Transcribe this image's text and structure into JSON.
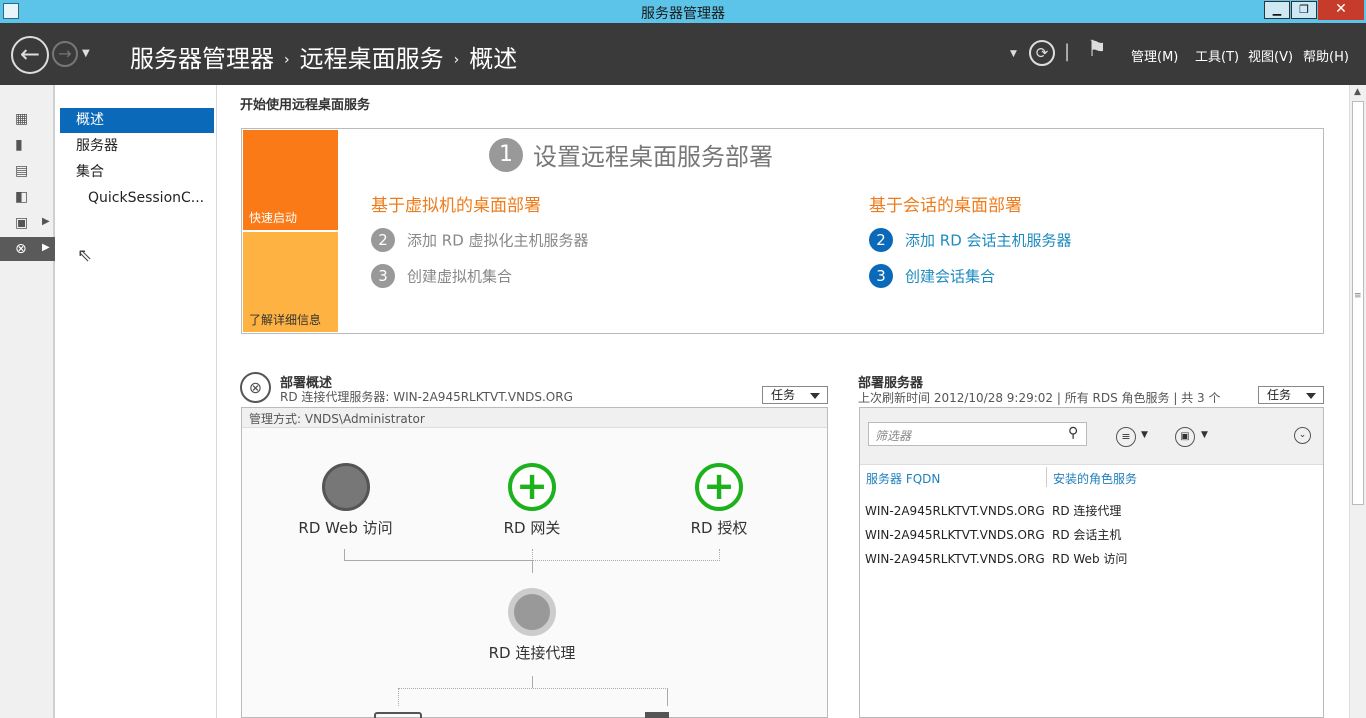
{
  "window": {
    "title": "服务器管理器",
    "min": "▁",
    "max": "❐",
    "close": "✕"
  },
  "header": {
    "breadcrumb": [
      "服务器管理器",
      "远程桌面服务",
      "概述"
    ],
    "menus": [
      "管理(M)",
      "工具(T)",
      "视图(V)",
      "帮助(H)"
    ],
    "sep": "|"
  },
  "sidenav": {
    "items": [
      "概述",
      "服务器",
      "集合",
      "QuickSessionC..."
    ]
  },
  "quickstart": {
    "section_title": "开始使用远程桌面服务",
    "tile_quick": "快速启动",
    "tile_learn": "了解详细信息",
    "step1_num": "1",
    "step1_title": "设置远程桌面服务部署",
    "left_heading": "基于虚拟机的桌面部署",
    "left_items": [
      {
        "num": "2",
        "label": "添加 RD 虚拟化主机服务器"
      },
      {
        "num": "3",
        "label": "创建虚拟机集合"
      }
    ],
    "right_heading": "基于会话的桌面部署",
    "right_items": [
      {
        "num": "2",
        "label": "添加 RD 会话主机服务器"
      },
      {
        "num": "3",
        "label": "创建会话集合"
      }
    ]
  },
  "overview": {
    "title": "部署概述",
    "subtitle": "RD 连接代理服务器: WIN-2A945RLKTVT.VNDS.ORG",
    "tasks": "任务",
    "managed_by": "管理方式: VNDS\\Administrator",
    "nodes": {
      "web": "RD Web 访问",
      "gateway": "RD 网关",
      "license": "RD 授权",
      "broker": "RD 连接代理"
    }
  },
  "servers": {
    "title": "部署服务器",
    "subtitle": "上次刷新时间 2012/10/28 9:29:02 | 所有 RDS 角色服务 | 共 3 个",
    "tasks": "任务",
    "filter_placeholder": "筛选器",
    "columns": [
      "服务器 FQDN",
      "安装的角色服务"
    ],
    "rows": [
      [
        "WIN-2A945RLKTVT.VNDS.ORG",
        "RD 连接代理"
      ],
      [
        "WIN-2A945RLKTVT.VNDS.ORG",
        "RD 会话主机"
      ],
      [
        "WIN-2A945RLKTVT.VNDS.ORG",
        "RD Web 访问"
      ]
    ]
  },
  "colors": {
    "titlebar": "#5bc4e8",
    "header": "#3a3a3a",
    "selected": "#0a69b9",
    "orange": "#fa7a18",
    "light_orange": "#fdb242",
    "link": "#1e8bc0"
  }
}
